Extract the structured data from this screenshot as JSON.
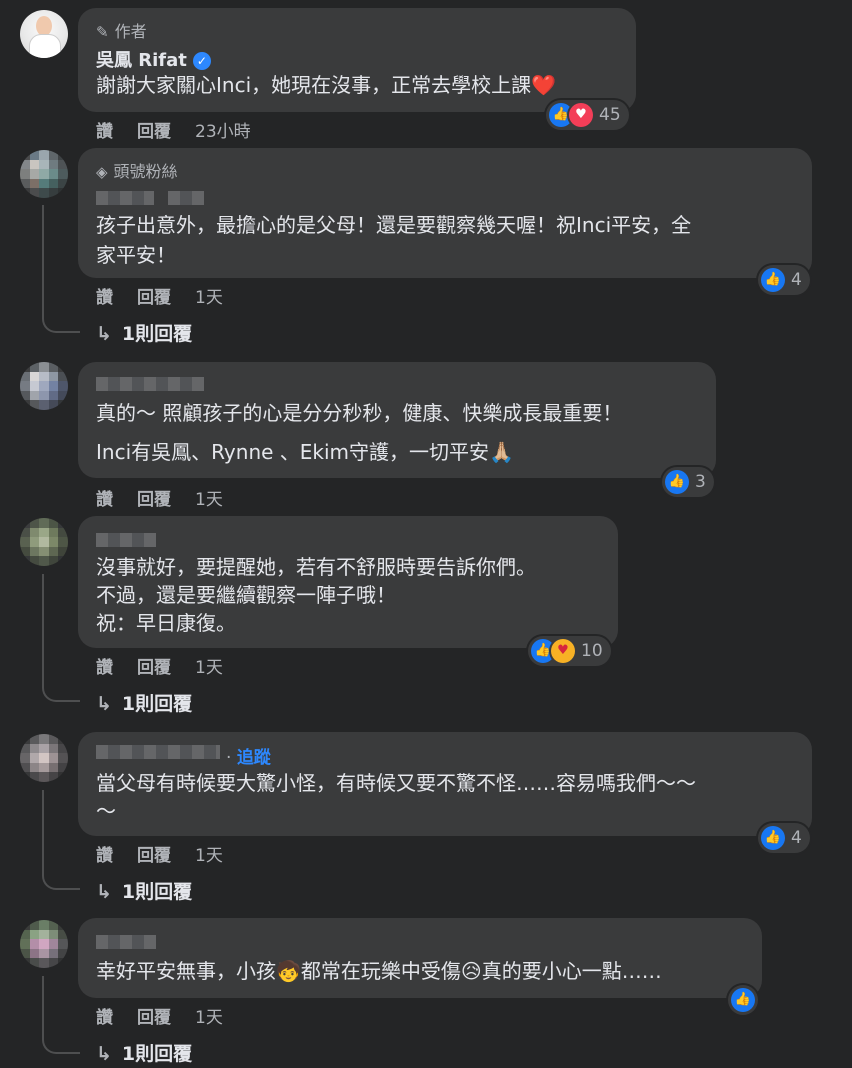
{
  "comments": [
    {
      "tag": "作者",
      "tag_icon": "pencil-icon",
      "name": "吳鳳 Rifat",
      "verified": true,
      "lines": [
        "謝謝大家關心Inci，她現在沒事，正常去學校上課❤️"
      ],
      "actions": {
        "like": "讚",
        "reply": "回覆",
        "time": "23小時"
      },
      "reaction_count": "45"
    },
    {
      "tag": "頭號粉絲",
      "tag_icon": "diamond-badge-icon",
      "lines": [
        "孩子出意外，最擔心的是父母！還是要觀察幾天喔！祝Inci平安，全",
        "家平安！"
      ],
      "actions": {
        "like": "讚",
        "reply": "回覆",
        "time": "1天"
      },
      "reaction_count": "4",
      "replies_label": "1則回覆"
    },
    {
      "lines": [
        "真的～ 照顧孩子的心是分分秒秒，健康、快樂成長最重要！",
        "Inci有吳鳳、Rynne 、Ekim守護，一切平安🙏🏼"
      ],
      "actions": {
        "like": "讚",
        "reply": "回覆",
        "time": "1天"
      },
      "reaction_count": "3"
    },
    {
      "lines": [
        "沒事就好，要提醒她，若有不舒服時要告訴你們。",
        "不過，還是要繼續觀察一陣子哦！",
        "祝：早日康復。"
      ],
      "actions": {
        "like": "讚",
        "reply": "回覆",
        "time": "1天"
      },
      "reaction_count": "10",
      "replies_label": "1則回覆"
    },
    {
      "follow": "追蹤",
      "lines": [
        "當父母有時候要大驚小怪，有時候又要不驚不怪……容易嗎我們～～",
        "～"
      ],
      "actions": {
        "like": "讚",
        "reply": "回覆",
        "time": "1天"
      },
      "reaction_count": "4",
      "replies_label": "1則回覆"
    },
    {
      "lines": [
        "幸好平安無事，小孩🧒都常在玩樂中受傷😥真的要小心一點……"
      ],
      "actions": {
        "like": "讚",
        "reply": "回覆",
        "time": "1天"
      },
      "replies_label": "1則回覆"
    }
  ],
  "colors": {
    "background": "#242526",
    "bubble": "#3a3b3c",
    "link": "#2d88ff",
    "like": "#1877f2"
  }
}
